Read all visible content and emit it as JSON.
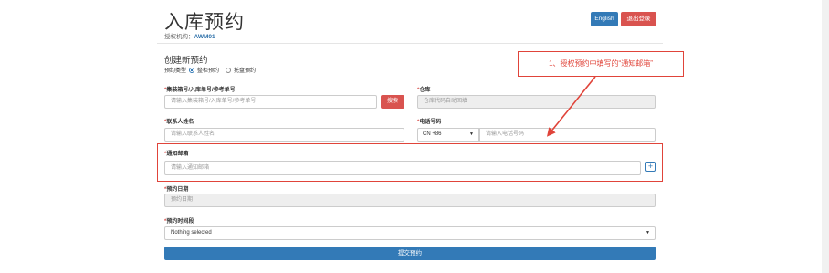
{
  "header": {
    "title": "入库预约",
    "org_label": "授权机构：",
    "org_code": "AWM01",
    "english_button": "English",
    "logout_button": "退出登录"
  },
  "form": {
    "section_title": "创建新预约",
    "booking_type_label": "预约类型",
    "booking_type_options": [
      "整柜预约",
      "托盘预约"
    ],
    "booking_type_selected": "整柜预约",
    "container_label": "集装箱号/入库单号/参考单号",
    "container_placeholder": "请输入集装箱号/入库单号/参考单号",
    "search_button": "搜索",
    "warehouse_label": "仓库",
    "warehouse_placeholder": "仓库代码自动回填",
    "contact_label": "联系人姓名",
    "contact_placeholder": "请输入联系人姓名",
    "phone_label": "电话号码",
    "phone_country": "CN +86",
    "phone_placeholder": "请输入电话号码",
    "email_label": "通知邮箱",
    "email_placeholder": "请输入通知邮箱",
    "add_button": "+",
    "date_label": "预约日期",
    "date_placeholder": "预约日期",
    "timeslot_label": "预约时间段",
    "timeslot_value": "Nothing selected",
    "submit_button": "提交预约"
  },
  "annotation": {
    "callout_text": "1、授权预约中填写的“通知邮箱”"
  },
  "colors": {
    "primary": "#337ab7",
    "danger": "#d9534f",
    "annotation_red": "#e0443a"
  }
}
